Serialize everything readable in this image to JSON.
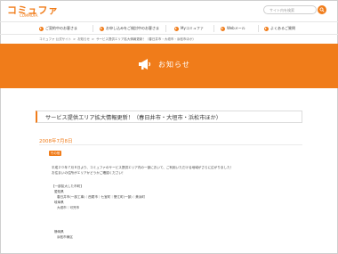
{
  "header": {
    "logo_text": "コミュファ",
    "logo_sub": "COMMUFA",
    "search_placeholder": "サイト内を検索"
  },
  "nav": {
    "items": [
      {
        "label": "ご契約中のお客さま"
      },
      {
        "label": "お申し込みをご検討中のお客さま"
      },
      {
        "label": "Myコミュファ"
      },
      {
        "label": "Webメール"
      },
      {
        "label": "よくあるご質問"
      }
    ]
  },
  "breadcrumb": {
    "items": [
      "コミュファ 公式サイト",
      "お知らせ",
      "サービス提供エリア拡大情報更新！（春日井市・大垣市・浜松市ほか）"
    ],
    "separator": ">"
  },
  "banner": {
    "title": "お知らせ"
  },
  "article": {
    "headline": "サービス提供エリア拡大情報更新！（春日井市・大垣市・浜松市ほか）",
    "date": "2008年7月8日",
    "tag": "その他",
    "lines": [
      "平成２０年７月８日より、コミュファのサービス提供エリア内の一部において、ご利用いただける地域がさらに広がりました！",
      "お住まいの住所がエリアかどうかご確認ください！",
      "",
      "【一部拡大した市町】",
      "愛知県",
      "春日井市(一部工事)｜西尾市｜七宝町｜蟹江町(一部)｜美浜町",
      "岐阜県",
      "大垣市｜可児市",
      "",
      "",
      "静岡県",
      "浜松市東区"
    ]
  }
}
